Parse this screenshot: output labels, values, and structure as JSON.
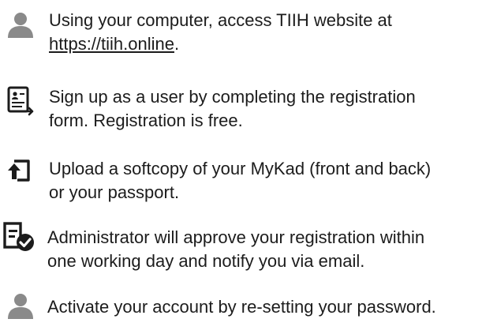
{
  "steps": [
    {
      "icon": "user-icon",
      "line1": "Using your computer, access TIIH website at",
      "link": "https://tiih.online",
      "link_suffix": "."
    },
    {
      "icon": "registration-form-icon",
      "line1": "Sign up as a user by completing the registration",
      "line2": "form. Registration is free."
    },
    {
      "icon": "upload-icon",
      "line1": "Upload a softcopy of your MyKad (front and back)",
      "line2": "or your passport."
    },
    {
      "icon": "approval-icon",
      "line1": "Administrator will approve your registration within",
      "line2": "one working day and notify you via email."
    },
    {
      "icon": "user-icon",
      "line1": "Activate your account by re-setting your password."
    }
  ]
}
